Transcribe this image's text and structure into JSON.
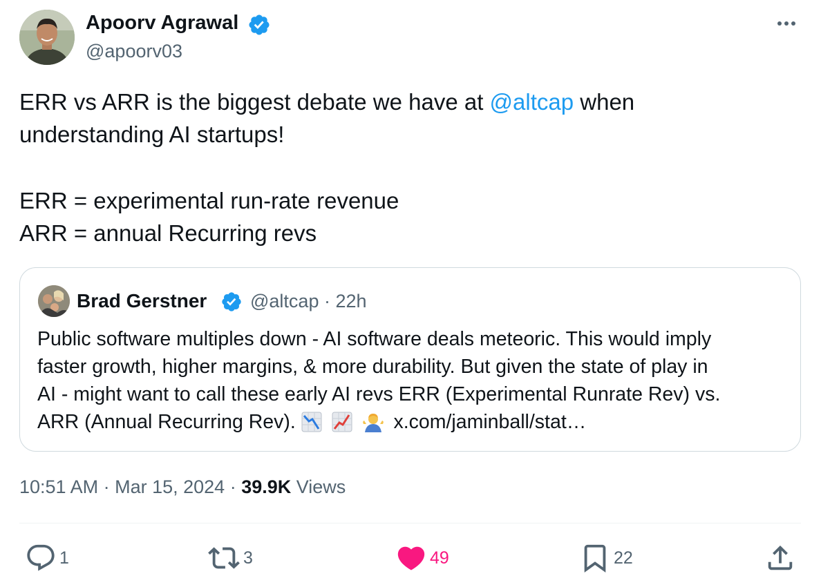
{
  "author": {
    "name": "Apoorv Agrawal",
    "handle": "@apoorv03",
    "verified": true
  },
  "tweet": {
    "lines": [
      {
        "before": "ERR vs ARR is the biggest debate we have at ",
        "mention": "@altcap",
        "after": " when"
      },
      {
        "text": "understanding AI startups!"
      },
      {
        "text": "ERR = experimental run-rate revenue"
      },
      {
        "text": "ARR = annual Recurring revs"
      }
    ]
  },
  "quote": {
    "name": "Brad Gerstner",
    "handle": "@altcap",
    "separator": "·",
    "time": "22h",
    "lines": [
      "Public software multiples down - AI software deals meteoric. This would imply",
      "faster growth, higher margins, & more durability.  But given the state of play in",
      "AI - might want to call these early AI revs ERR (Experimental Runrate Rev) vs.",
      "ARR (Annual Recurring Rev). "
    ],
    "emojis": [
      "chart-decreasing-emoji",
      "chart-increasing-emoji",
      "person-shrugging-emoji"
    ],
    "link": "x.com/jaminball/stat…"
  },
  "meta": {
    "time": "10:51 AM",
    "separator": " · ",
    "date": "Mar 15, 2024",
    "views_count": "39.9K",
    "views_label": " Views"
  },
  "actions": {
    "reply_count": "1",
    "retweet_count": "3",
    "like_count": "49",
    "bookmark_count": "22"
  },
  "colors": {
    "accent": "#1d9bf0",
    "like": "#f91880",
    "secondary_text": "#536471"
  },
  "icons": [
    "verified-badge-icon",
    "more-icon",
    "reply-icon",
    "retweet-icon",
    "like-icon",
    "bookmark-icon",
    "share-icon"
  ]
}
